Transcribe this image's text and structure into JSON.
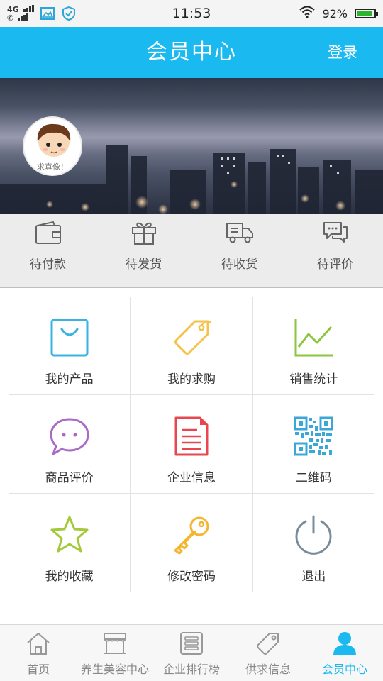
{
  "status_bar": {
    "network": "4G",
    "time": "11:53",
    "battery": "92%",
    "battery_level": 0.92
  },
  "header": {
    "title": "会员中心",
    "login_label": "登录"
  },
  "banner": {
    "avatar_caption": "求真像！"
  },
  "order_strip": [
    {
      "label": "待付款",
      "icon": "wallet-icon"
    },
    {
      "label": "待发货",
      "icon": "gift-icon"
    },
    {
      "label": "待收货",
      "icon": "delivery-truck-icon"
    },
    {
      "label": "待评价",
      "icon": "chat-bubbles-icon"
    }
  ],
  "grid": [
    {
      "label": "我的产品",
      "icon": "shopping-bag-icon",
      "color": "#3bb3e0"
    },
    {
      "label": "我的求购",
      "icon": "price-tag-icon",
      "color": "#f5c24a"
    },
    {
      "label": "销售统计",
      "icon": "line-chart-icon",
      "color": "#8cc63f"
    },
    {
      "label": "商品评价",
      "icon": "comment-icon",
      "color": "#a86bc8"
    },
    {
      "label": "企业信息",
      "icon": "document-icon",
      "color": "#e8474f"
    },
    {
      "label": "二维码",
      "icon": "qr-code-icon",
      "color": "#3ba7d8"
    },
    {
      "label": "我的收藏",
      "icon": "star-icon",
      "color": "#a4c93a"
    },
    {
      "label": "修改密码",
      "icon": "key-icon",
      "color": "#f5b52e"
    },
    {
      "label": "退出",
      "icon": "power-icon",
      "color": "#7a8c99"
    }
  ],
  "tabbar": [
    {
      "label": "首页",
      "icon": "home-icon",
      "active": false
    },
    {
      "label": "养生美容中心",
      "icon": "storefront-icon",
      "active": false
    },
    {
      "label": "企业排行榜",
      "icon": "ranking-list-icon",
      "active": false
    },
    {
      "label": "供求信息",
      "icon": "tag-icon",
      "active": false
    },
    {
      "label": "会员中心",
      "icon": "user-icon",
      "active": true
    }
  ],
  "colors": {
    "brand": "#1ab9f0",
    "tab_inactive": "#888888"
  }
}
